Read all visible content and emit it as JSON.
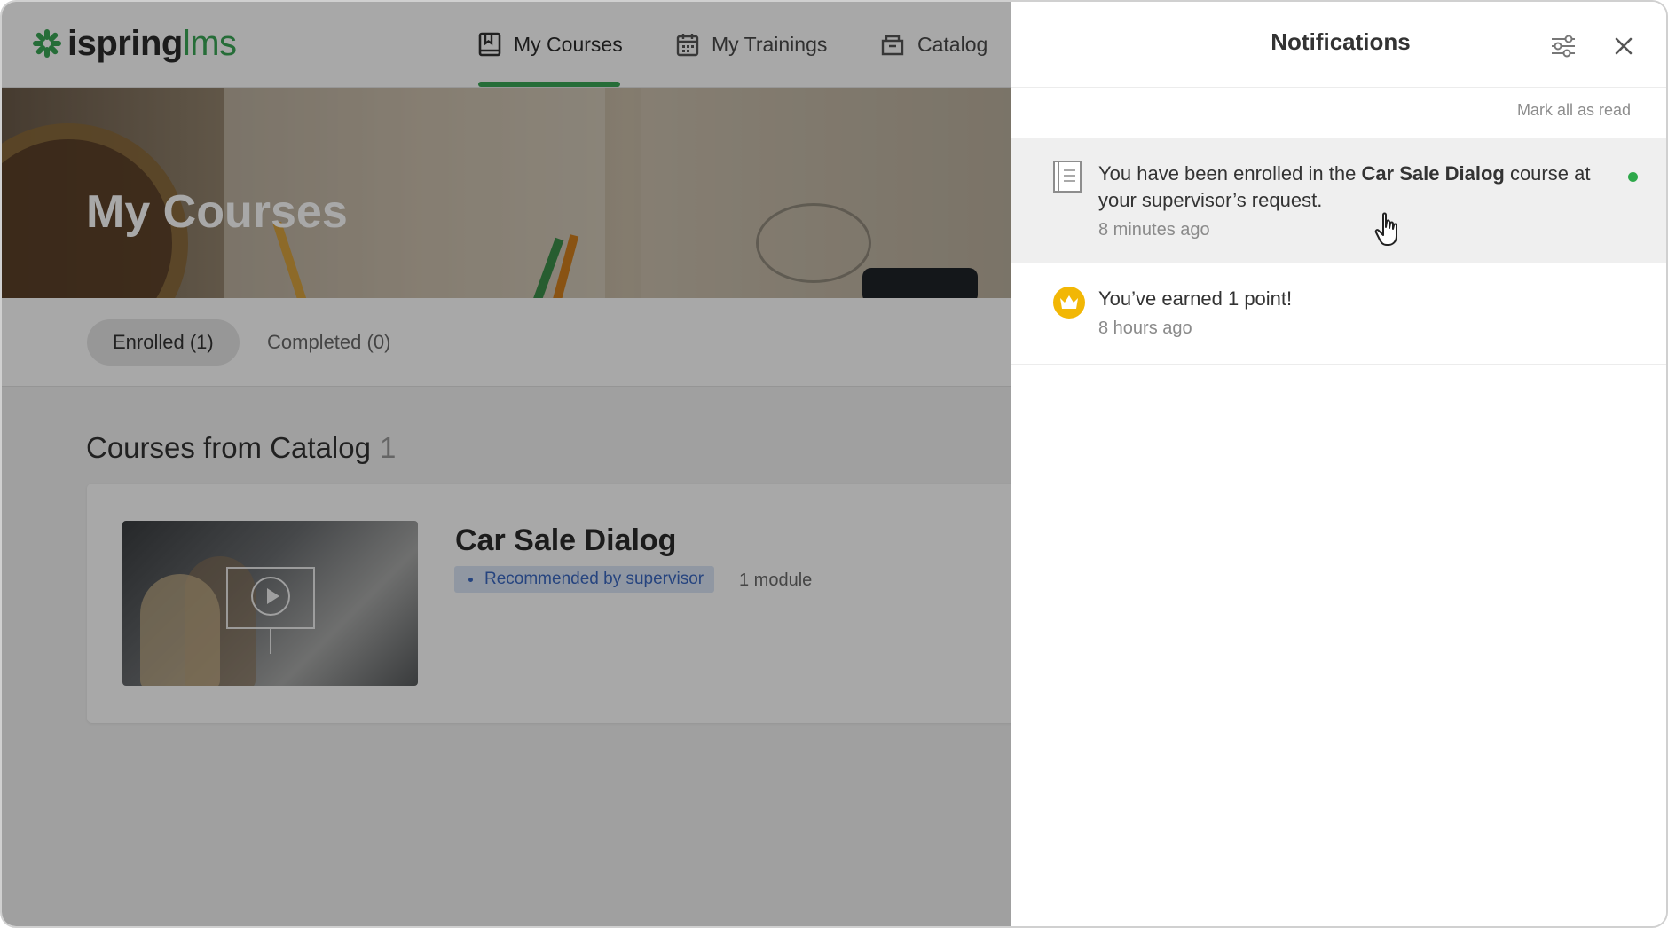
{
  "app": {
    "logo_main": "ispring",
    "logo_sub": "lms"
  },
  "nav": {
    "my_courses": "My Courses",
    "my_trainings": "My Trainings",
    "catalog": "Catalog"
  },
  "page": {
    "title": "My Courses",
    "tabs": [
      {
        "label": "Enrolled (1)",
        "active": true
      },
      {
        "label": "Completed (0)",
        "active": false
      }
    ],
    "section_title": "Courses from Catalog",
    "section_count": "1",
    "course": {
      "title": "Car Sale Dialog",
      "badge": "Recommended by supervisor",
      "modules": "1 module"
    }
  },
  "notifications_panel": {
    "title": "Notifications",
    "mark_all": "Mark all as read",
    "items": [
      {
        "icon": "document-icon",
        "text_before": "You have been enrolled in the ",
        "text_bold": "Car Sale Dialog",
        "text_after": " course at your supervisor’s request.",
        "time": "8 minutes ago",
        "unread": true
      },
      {
        "icon": "crown-icon",
        "text": "You’ve earned 1 point!",
        "time": "8 hours ago",
        "unread": false
      }
    ]
  },
  "colors": {
    "accent": "#3aa655",
    "badge_bg": "#dbe6f6",
    "badge_text": "#3a68c1",
    "unread_dot": "#2ea84a",
    "crown": "#f2b705"
  }
}
